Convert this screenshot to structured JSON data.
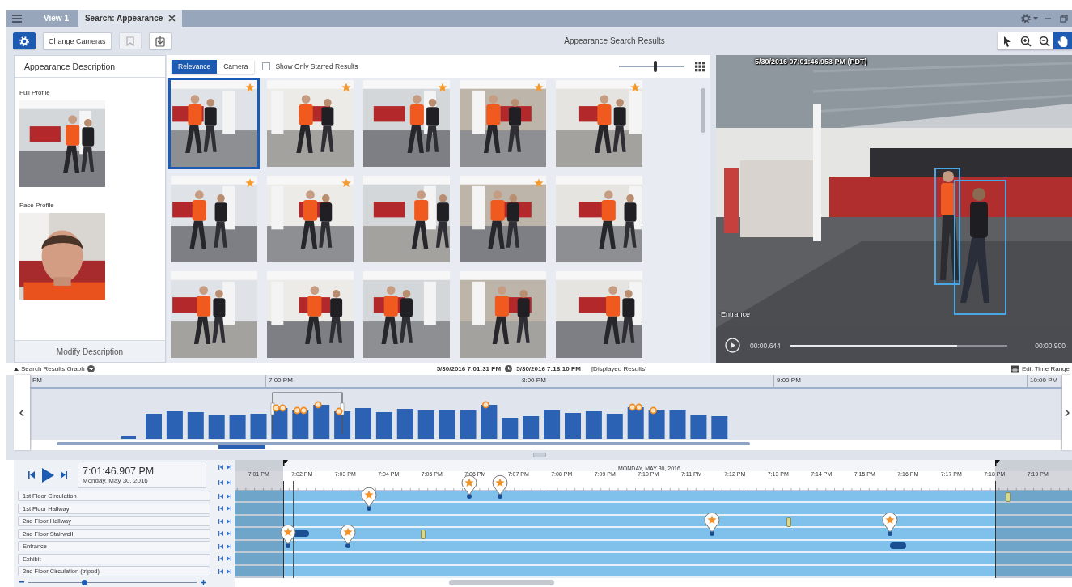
{
  "tabs": [
    {
      "label": "View 1",
      "selected": false,
      "closable": false
    },
    {
      "label": "Search: Appearance",
      "selected": true,
      "closable": true
    }
  ],
  "toolbar": {
    "buttons": [
      {
        "kind": "settings",
        "disabled": false
      },
      {
        "kind": "text",
        "label": "Change Cameras",
        "disabled": false
      },
      {
        "kind": "bookmark",
        "disabled": true
      },
      {
        "kind": "export",
        "disabled": false
      }
    ],
    "title": "Appearance Search Results",
    "tools": [
      {
        "kind": "pointer",
        "selected": false
      },
      {
        "kind": "zoom-in",
        "selected": false
      },
      {
        "kind": "zoom-out",
        "selected": false
      },
      {
        "kind": "pan",
        "selected": true
      }
    ]
  },
  "description": {
    "title": "Appearance Description",
    "profiles": [
      {
        "label": "Full Profile",
        "kind": "body"
      },
      {
        "label": "Face Profile",
        "kind": "face"
      }
    ],
    "button": "Modify Description"
  },
  "results": {
    "sort": [
      {
        "label": "Relevance",
        "selected": true
      },
      {
        "label": "Camera",
        "selected": false
      }
    ],
    "starred_only": {
      "label": "Show Only Starred Results",
      "checked": false
    },
    "size": {
      "level": 0.56
    },
    "thumbnails": [
      {
        "starred": true,
        "selected": true
      },
      {
        "starred": true,
        "selected": false
      },
      {
        "starred": true,
        "selected": false
      },
      {
        "starred": true,
        "selected": false
      },
      {
        "starred": true,
        "selected": false
      },
      {
        "starred": true,
        "selected": false
      },
      {
        "starred": true,
        "selected": false
      },
      {
        "starred": false,
        "selected": false
      },
      {
        "starred": true,
        "selected": false
      },
      {
        "starred": false,
        "selected": false
      },
      {
        "starred": false,
        "selected": false
      },
      {
        "starred": false,
        "selected": false
      },
      {
        "starred": false,
        "selected": false
      },
      {
        "starred": false,
        "selected": false
      },
      {
        "starred": false,
        "selected": false
      }
    ]
  },
  "video": {
    "timestamp": "5/30/2016 07:01:46.953 PM (PDT)",
    "camera": "Entrance",
    "elapsed": "00:00.644",
    "duration": "00:00.900",
    "progress": {
      "level": 0.77
    }
  },
  "graph": {
    "title": "Search Results Graph",
    "range_start": "5/30/2016 7:01:31 PM",
    "range_end": "5/30/2016 7:18:10 PM",
    "range_note": "[Displayed Results]",
    "edit_button": "Edit Time Range",
    "axis_labels": [
      "PM",
      "7:00 PM",
      "8:00 PM",
      "9:00 PM",
      "10:00 PM"
    ]
  },
  "timeline": {
    "time": "7:01:46.907 PM",
    "date": "Monday, May 30, 2016",
    "day_heading": "MONDAY, MAY 30, 2016",
    "ticks": [
      "7:01 PM",
      "7:02 PM",
      "7:03 PM",
      "7:04 PM",
      "7:05 PM",
      "7:06 PM",
      "7:07 PM",
      "7:08 PM",
      "7:09 PM",
      "7:10 PM",
      "7:11 PM",
      "7:12 PM",
      "7:13 PM",
      "7:14 PM",
      "7:15 PM",
      "7:16 PM",
      "7:17 PM",
      "7:18 PM",
      "7:19 PM"
    ],
    "cameras": [
      {
        "name": "1st Floor Circulation"
      },
      {
        "name": "1st Floor Hallway"
      },
      {
        "name": "2nd Floor Hallway"
      },
      {
        "name": "2nd Floor Stairwell"
      },
      {
        "name": "Entrance"
      },
      {
        "name": "Exhibit"
      },
      {
        "name": "2nd Floor Circulation (tripod)"
      }
    ],
    "zoom": {
      "level": 0.33
    }
  }
}
